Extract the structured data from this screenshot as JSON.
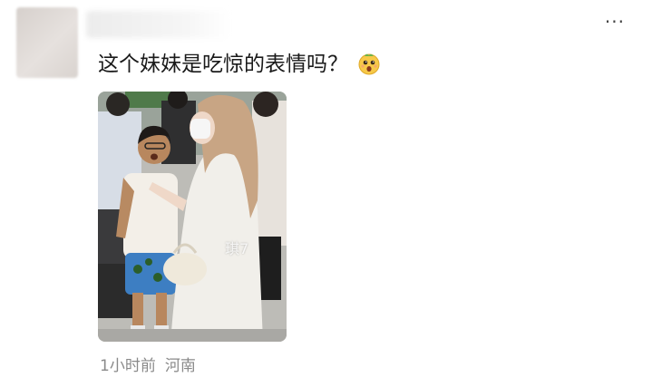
{
  "post": {
    "text": "这个妹妹是吃惊的表情吗？",
    "emoji_icon": "surprised-face-icon",
    "more_icon": "more-dots-icon",
    "more_label": "···"
  },
  "image": {
    "watermark": "琪7"
  },
  "meta": {
    "time": "1小时前",
    "location": "河南"
  },
  "colors": {
    "text": "#1a1a1a",
    "meta": "#8a8a8a",
    "background": "#ffffff"
  }
}
